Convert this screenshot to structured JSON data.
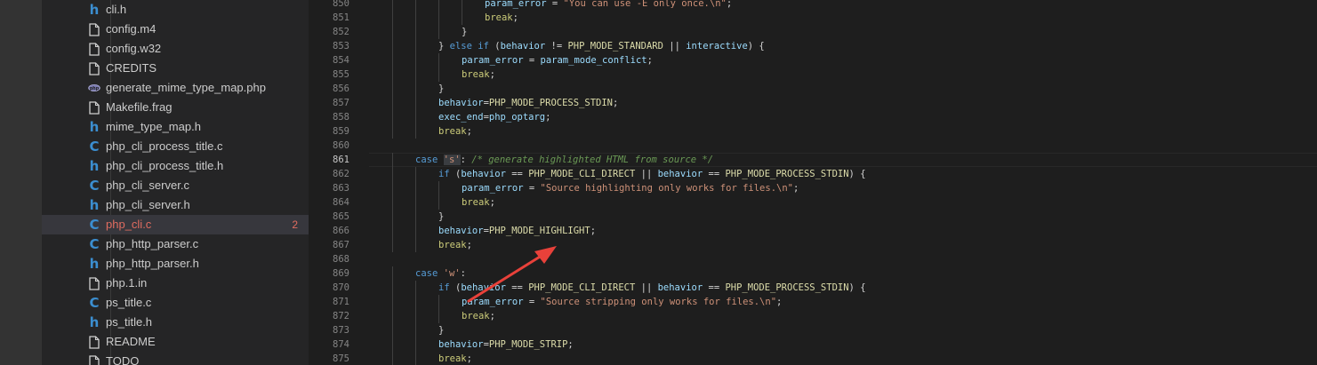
{
  "sidebar": {
    "files": [
      {
        "name": "cli.h",
        "icon": "h-file-icon"
      },
      {
        "name": "config.m4",
        "icon": "document-icon"
      },
      {
        "name": "config.w32",
        "icon": "document-icon"
      },
      {
        "name": "CREDITS",
        "icon": "document-icon"
      },
      {
        "name": "generate_mime_type_map.php",
        "icon": "php-icon"
      },
      {
        "name": "Makefile.frag",
        "icon": "document-icon"
      },
      {
        "name": "mime_type_map.h",
        "icon": "h-file-icon"
      },
      {
        "name": "php_cli_process_title.c",
        "icon": "c-file-icon"
      },
      {
        "name": "php_cli_process_title.h",
        "icon": "h-file-icon"
      },
      {
        "name": "php_cli_server.c",
        "icon": "c-file-icon"
      },
      {
        "name": "php_cli_server.h",
        "icon": "h-file-icon"
      },
      {
        "name": "php_cli.c",
        "icon": "c-file-icon",
        "active": true,
        "badge": "2"
      },
      {
        "name": "php_http_parser.c",
        "icon": "c-file-icon"
      },
      {
        "name": "php_http_parser.h",
        "icon": "h-file-icon"
      },
      {
        "name": "php.1.in",
        "icon": "document-icon"
      },
      {
        "name": "ps_title.c",
        "icon": "c-file-icon"
      },
      {
        "name": "ps_title.h",
        "icon": "h-file-icon"
      },
      {
        "name": "README",
        "icon": "document-icon"
      },
      {
        "name": "TODO",
        "icon": "document-icon"
      }
    ]
  },
  "editor": {
    "current_line": "861",
    "lines": [
      {
        "num": "850",
        "text": "\t\t\t\t\tparam_error = \"You can use -E only once.\\n\";"
      },
      {
        "num": "851",
        "text": "\t\t\t\t\tbreak;"
      },
      {
        "num": "852",
        "text": "\t\t\t\t}"
      },
      {
        "num": "853",
        "text": "\t\t\t} else if (behavior != PHP_MODE_STANDARD || interactive) {"
      },
      {
        "num": "854",
        "text": "\t\t\t\tparam_error = param_mode_conflict;"
      },
      {
        "num": "855",
        "text": "\t\t\t\tbreak;"
      },
      {
        "num": "856",
        "text": "\t\t\t}"
      },
      {
        "num": "857",
        "text": "\t\t\tbehavior=PHP_MODE_PROCESS_STDIN;"
      },
      {
        "num": "858",
        "text": "\t\t\texec_end=php_optarg;"
      },
      {
        "num": "859",
        "text": "\t\t\tbreak;"
      },
      {
        "num": "860",
        "text": ""
      },
      {
        "num": "861",
        "text": "\t\tcase 's': /* generate highlighted HTML from source */"
      },
      {
        "num": "862",
        "text": "\t\t\tif (behavior == PHP_MODE_CLI_DIRECT || behavior == PHP_MODE_PROCESS_STDIN) {"
      },
      {
        "num": "863",
        "text": "\t\t\t\tparam_error = \"Source highlighting only works for files.\\n\";"
      },
      {
        "num": "864",
        "text": "\t\t\t\tbreak;"
      },
      {
        "num": "865",
        "text": "\t\t\t}"
      },
      {
        "num": "866",
        "text": "\t\t\tbehavior=PHP_MODE_HIGHLIGHT;"
      },
      {
        "num": "867",
        "text": "\t\t\tbreak;"
      },
      {
        "num": "868",
        "text": ""
      },
      {
        "num": "869",
        "text": "\t\tcase 'w':"
      },
      {
        "num": "870",
        "text": "\t\t\tif (behavior == PHP_MODE_CLI_DIRECT || behavior == PHP_MODE_PROCESS_STDIN) {"
      },
      {
        "num": "871",
        "text": "\t\t\t\tparam_error = \"Source stripping only works for files.\\n\";"
      },
      {
        "num": "872",
        "text": "\t\t\t\tbreak;"
      },
      {
        "num": "873",
        "text": "\t\t\t}"
      },
      {
        "num": "874",
        "text": "\t\t\tbehavior=PHP_MODE_STRIP;"
      },
      {
        "num": "875",
        "text": "\t\t\tbreak;"
      }
    ]
  },
  "annotation": {
    "color": "#e8413a"
  },
  "colors": {
    "activity_bar": "#333333",
    "sidebar": "#252526",
    "editor": "#1e1e1e",
    "active_file": "#e06c60"
  }
}
